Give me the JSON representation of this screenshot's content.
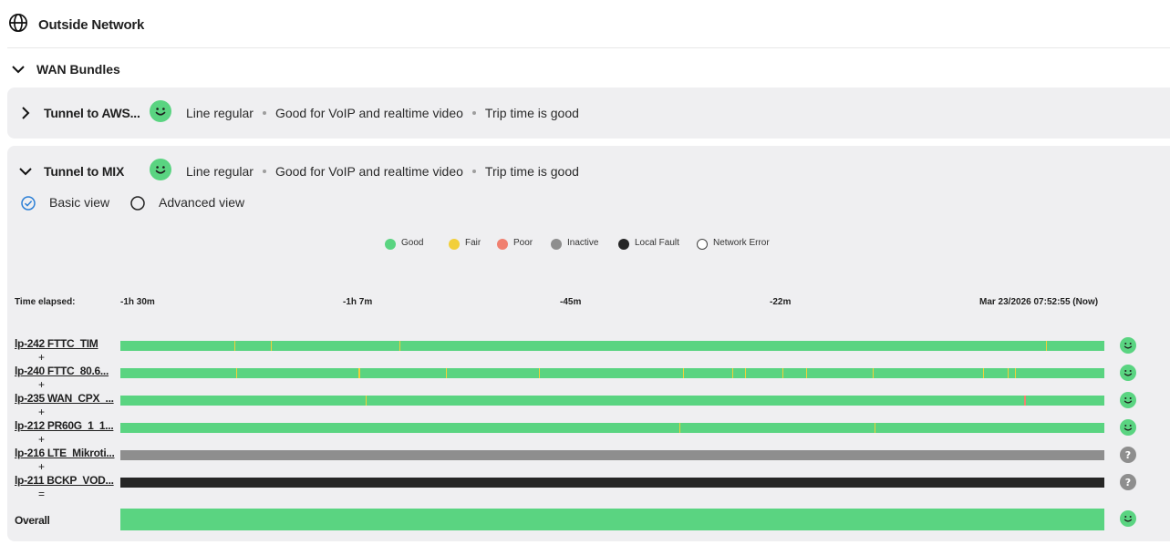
{
  "header": {
    "title": "Outside Network",
    "icon": "globe-icon"
  },
  "bundles": {
    "label": "WAN Bundles"
  },
  "colors": {
    "good": "#5ad481",
    "fair": "#f2cf3a",
    "poor": "#f08070",
    "inactive": "#8e8e8e",
    "local_fault": "#262626",
    "network_error": "#ffffff"
  },
  "tunnels": [
    {
      "name": "Tunnel to AWS...",
      "expanded": false,
      "status": [
        "Line regular",
        "Good for VoIP and realtime video",
        "Trip time is good"
      ]
    },
    {
      "name": "Tunnel to MIX",
      "expanded": true,
      "status": [
        "Line regular",
        "Good for VoIP and realtime video",
        "Trip time is good"
      ]
    }
  ],
  "views": {
    "basic": "Basic view",
    "advanced": "Advanced view",
    "selected": "basic"
  },
  "legend": [
    {
      "label": "Good",
      "color": "#5ad481"
    },
    {
      "label": "Fair",
      "color": "#f2cf3a"
    },
    {
      "label": "Poor",
      "color": "#f08070"
    },
    {
      "label": "Inactive",
      "color": "#8e8e8e"
    },
    {
      "label": "Local Fault",
      "color": "#262626"
    },
    {
      "label": "Network Error",
      "color": "#ffffff"
    }
  ],
  "timeline": {
    "label": "Time elapsed:",
    "ticks": [
      "-1h 30m",
      "-1h 7m",
      "-45m",
      "-22m",
      "Mar 23/2026 07:52:55 (Now)"
    ],
    "total_minutes": 90
  },
  "links": [
    {
      "name": "lp-242 FTTC_TIM",
      "op": "+",
      "base": "good",
      "icon": "smiley",
      "marks": [
        {
          "at": 0.116,
          "s": "fair"
        },
        {
          "at": 0.153,
          "s": "fair"
        },
        {
          "at": 0.284,
          "s": "fair"
        },
        {
          "at": 0.941,
          "s": "fair"
        }
      ]
    },
    {
      "name": "lp-240 FTTC_80.6...",
      "op": "+",
      "base": "good",
      "icon": "smiley",
      "marks": [
        {
          "at": 0.118,
          "s": "fair"
        },
        {
          "at": 0.242,
          "s": "fair"
        },
        {
          "at": 0.243,
          "s": "fair"
        },
        {
          "at": 0.331,
          "s": "fair"
        },
        {
          "at": 0.425,
          "s": "fair"
        },
        {
          "at": 0.572,
          "s": "fair"
        },
        {
          "at": 0.622,
          "s": "fair"
        },
        {
          "at": 0.635,
          "s": "fair"
        },
        {
          "at": 0.673,
          "s": "fair"
        },
        {
          "at": 0.697,
          "s": "fair"
        },
        {
          "at": 0.765,
          "s": "fair"
        },
        {
          "at": 0.877,
          "s": "fair"
        },
        {
          "at": 0.902,
          "s": "fair"
        },
        {
          "at": 0.909,
          "s": "fair"
        }
      ]
    },
    {
      "name": "lp-235 WAN_CPX_...",
      "op": "+",
      "base": "good",
      "icon": "smiley",
      "marks": [
        {
          "at": 0.249,
          "s": "fair"
        },
        {
          "at": 0.918,
          "s": "poor"
        }
      ]
    },
    {
      "name": "lp-212 PR60G_1_1...",
      "op": "+",
      "base": "good",
      "icon": "smiley",
      "marks": [
        {
          "at": 0.568,
          "s": "fair"
        },
        {
          "at": 0.766,
          "s": "fair"
        }
      ]
    },
    {
      "name": "lp-216 LTE_Mikroti...",
      "op": "+",
      "base": "inactive",
      "icon": "question",
      "marks": []
    },
    {
      "name": "lp-211 BCKP_VOD...",
      "op": "=",
      "base": "local_fault",
      "icon": "question",
      "marks": []
    }
  ],
  "overall": {
    "label": "Overall",
    "base": "good",
    "icon": "smiley"
  }
}
